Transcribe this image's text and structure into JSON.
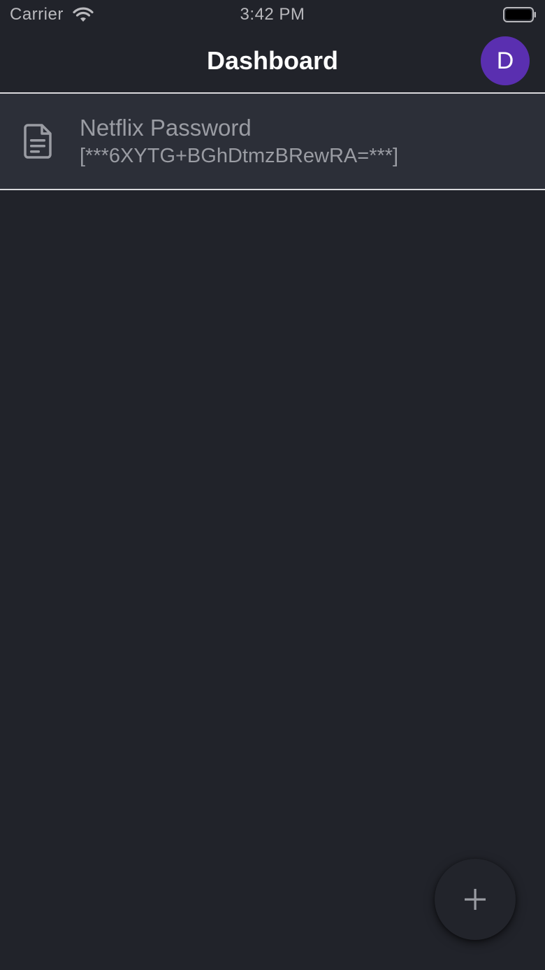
{
  "status_bar": {
    "carrier": "Carrier",
    "time": "3:42 PM",
    "wifi_icon": "wifi-icon",
    "battery_icon": "battery-icon"
  },
  "nav": {
    "title": "Dashboard",
    "avatar_initial": "D",
    "avatar_color": "#5a2fb0"
  },
  "list": {
    "items": [
      {
        "icon": "document-icon",
        "title": "Netflix Password",
        "subtitle": "[***6XYTG+BGhDtmzBRewRA=***]"
      }
    ]
  },
  "fab": {
    "icon": "plus-icon"
  },
  "colors": {
    "background": "#21232a",
    "list_item_background": "#2c2f38",
    "divider": "#d9d9dc",
    "muted_text": "#9a9ca3"
  }
}
